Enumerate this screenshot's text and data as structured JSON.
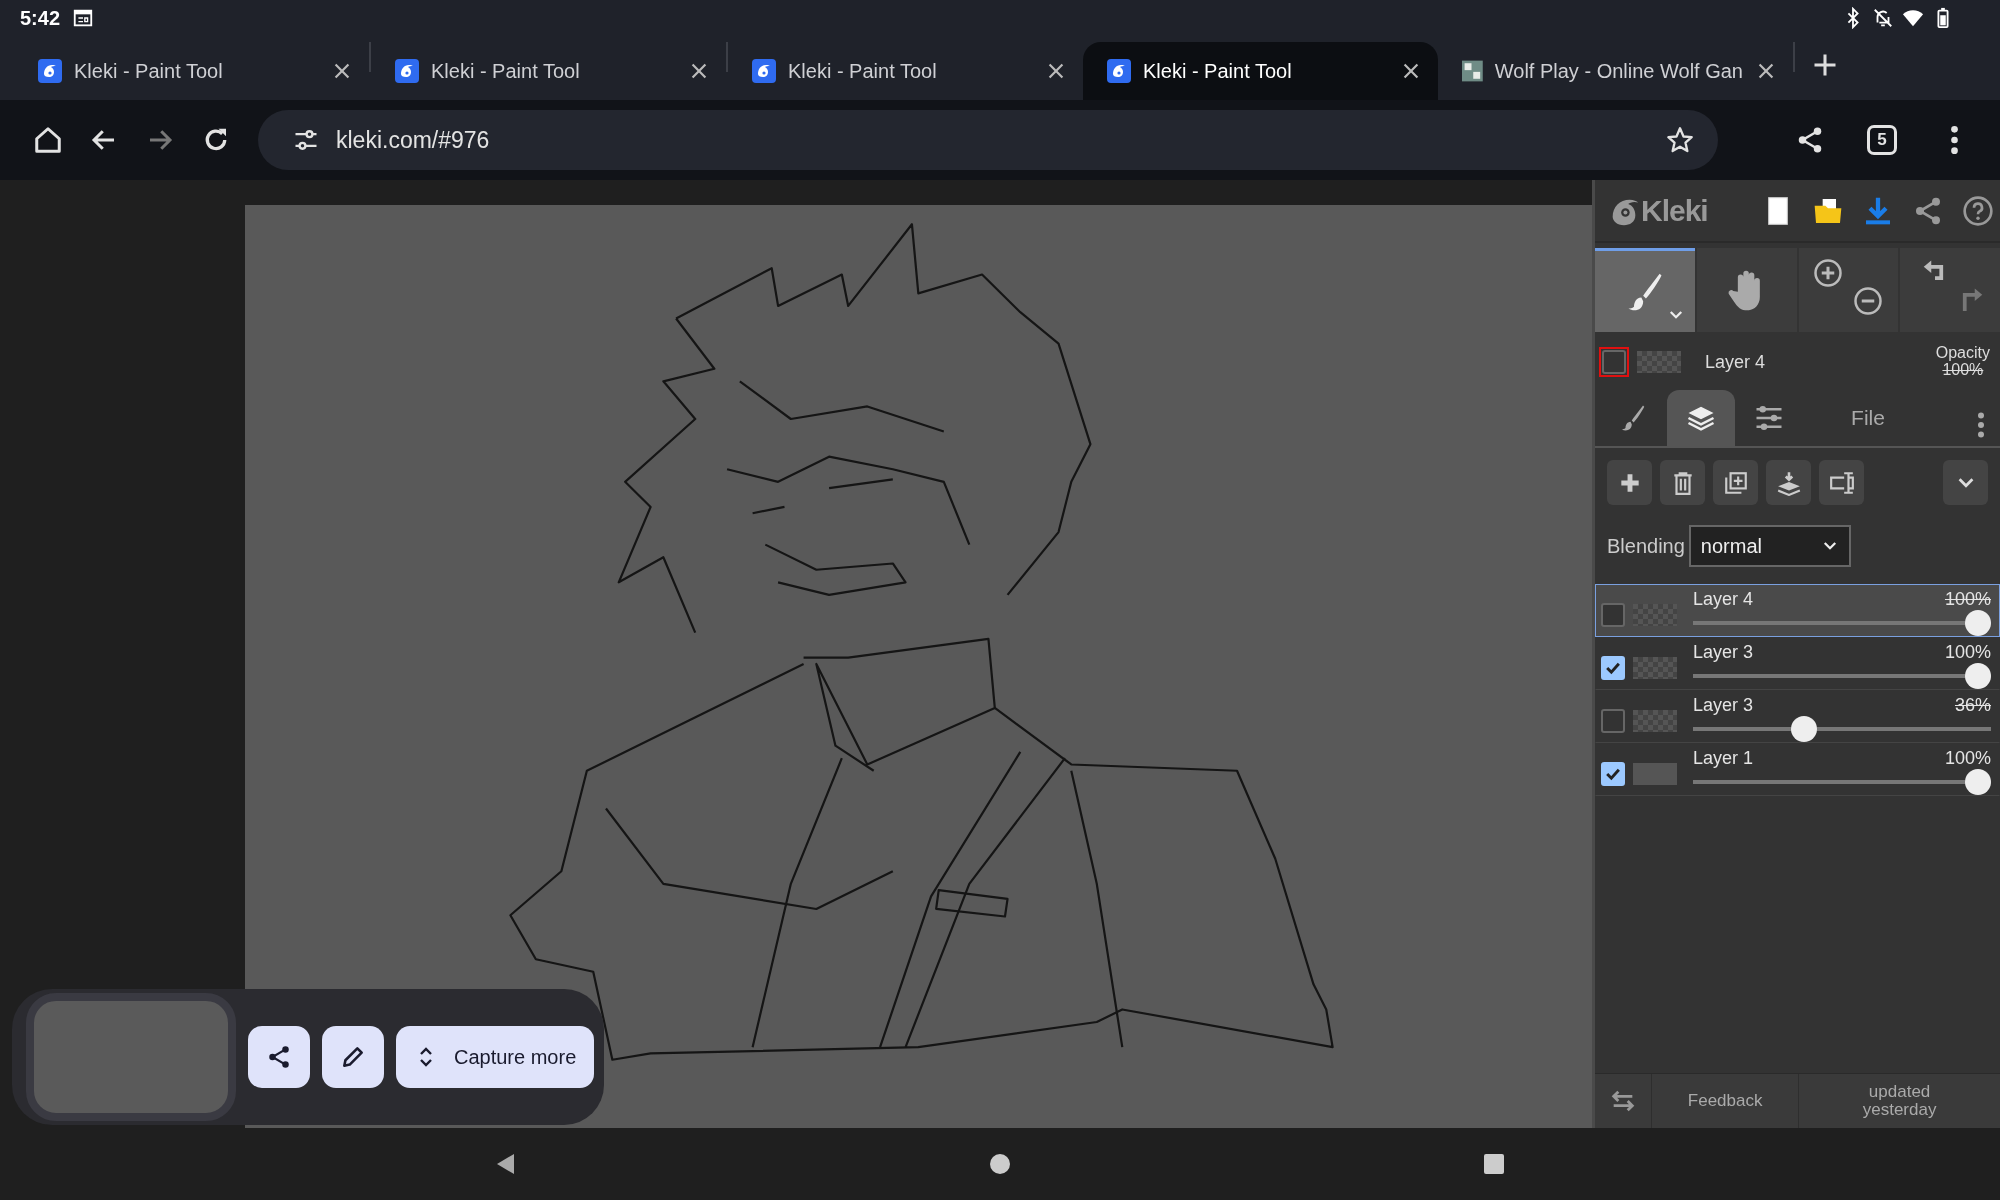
{
  "status_bar": {
    "time": "5:42"
  },
  "browser": {
    "tabs": [
      {
        "title": "Kleki - Paint Tool",
        "kind": "kleki",
        "selected": false
      },
      {
        "title": "Kleki - Paint Tool",
        "kind": "kleki",
        "selected": false
      },
      {
        "title": "Kleki - Paint Tool",
        "kind": "kleki",
        "selected": false
      },
      {
        "title": "Kleki - Paint Tool",
        "kind": "kleki",
        "selected": true
      },
      {
        "title": "Wolf Play - Online Wolf Gan",
        "kind": "site",
        "selected": false
      }
    ],
    "address": "kleki.com/#976",
    "tab_count": "5"
  },
  "kleki": {
    "logo": "Kleki",
    "tools": [
      {
        "kind": "brush",
        "selected": true
      },
      {
        "kind": "hand",
        "selected": false
      }
    ],
    "current_layer": {
      "name": "Layer 4",
      "opacity_label": "Opacity",
      "opacity": "100%",
      "checked": false
    },
    "panel_tabs": [
      {
        "kind": "brush",
        "selected": false
      },
      {
        "kind": "layers",
        "selected": true
      },
      {
        "kind": "adjust",
        "selected": false
      },
      {
        "kind": "text",
        "label": "File",
        "selected": false
      }
    ],
    "blending": {
      "label": "Blending",
      "value": "normal"
    },
    "layers": [
      {
        "name": "Layer 4",
        "opacity": "100%",
        "checked": false,
        "level": 1,
        "selected": true
      },
      {
        "name": "Layer 3",
        "opacity": "100%",
        "checked": true,
        "level": 1,
        "selected": false
      },
      {
        "name": "Layer 3",
        "opacity": "36%",
        "checked": false,
        "level": 0.36,
        "selected": false
      },
      {
        "name": "Layer 1",
        "opacity": "100%",
        "checked": true,
        "level": 1,
        "selected": false
      }
    ],
    "footer": {
      "feedback": "Feedback",
      "updated": "updated yesterday"
    }
  },
  "screenshot_toolbar": {
    "capture_label": "Capture more"
  }
}
